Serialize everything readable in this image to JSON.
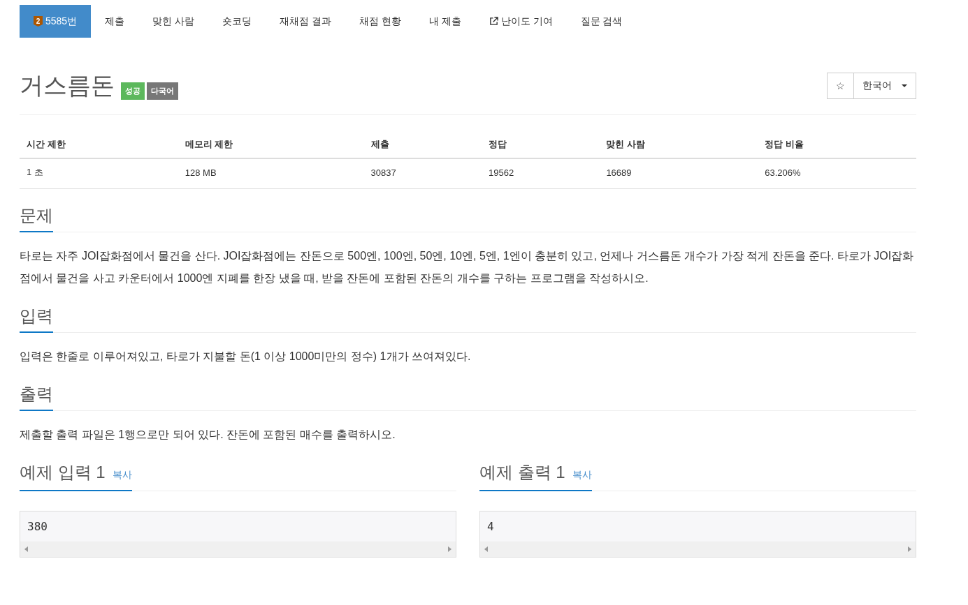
{
  "nav": [
    {
      "label": "5585번",
      "selected": true,
      "badge": "2",
      "kind": "problem"
    },
    {
      "label": "제출",
      "selected": false,
      "kind": "plain"
    },
    {
      "label": "맞힌 사람",
      "selected": false,
      "kind": "plain"
    },
    {
      "label": "숏코딩",
      "selected": false,
      "kind": "plain"
    },
    {
      "label": "재채점 결과",
      "selected": false,
      "kind": "plain"
    },
    {
      "label": "채점 현황",
      "selected": false,
      "kind": "plain"
    },
    {
      "label": "내 제출",
      "selected": false,
      "kind": "plain"
    },
    {
      "label": "난이도 기여",
      "selected": false,
      "kind": "external"
    },
    {
      "label": "질문 검색",
      "selected": false,
      "kind": "plain"
    }
  ],
  "problem": {
    "title": "거스름돈",
    "labels": [
      {
        "text": "성공",
        "color": "#5cb85c"
      },
      {
        "text": "다국어",
        "color": "#777777"
      }
    ],
    "star": "☆",
    "language": "한국어"
  },
  "info_table": {
    "columns": [
      "시간 제한",
      "메모리 제한",
      "제출",
      "정답",
      "맞힌 사람",
      "정답 비율"
    ],
    "rows": [
      [
        "1 초",
        "128 MB",
        "30837",
        "19562",
        "16689",
        "63.206%"
      ]
    ]
  },
  "sections": [
    {
      "heading": "문제",
      "text": "타로는 자주 JOI잡화점에서 물건을 산다. JOI잡화점에는 잔돈으로 500엔, 100엔, 50엔, 10엔, 5엔, 1엔이 충분히 있고, 언제나 거스름돈 개수가 가장 적게 잔돈을 준다. 타로가 JOI잡화점에서 물건을 사고 카운터에서 1000엔 지폐를 한장 냈을 때, 받을 잔돈에 포함된 잔돈의 개수를 구하는 프로그램을 작성하시오."
    },
    {
      "heading": "입력",
      "text": "입력은 한줄로 이루어져있고, 타로가 지불할 돈(1 이상 1000미만의 정수) 1개가 쓰여져있다."
    },
    {
      "heading": "출력",
      "text": "제출할 출력 파일은 1행으로만 되어 있다. 잔돈에 포함된 매수를 출력하시오."
    }
  ],
  "samples": [
    {
      "heading": "예제 입력 1",
      "copy": "복사",
      "content": "380"
    },
    {
      "heading": "예제 출력 1",
      "copy": "복사",
      "content": "4"
    }
  ]
}
